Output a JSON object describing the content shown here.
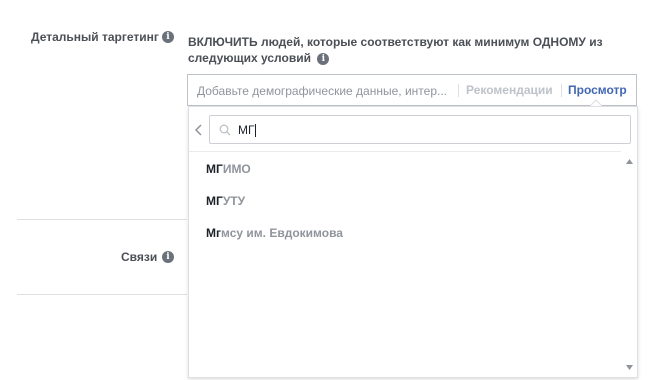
{
  "detailed_targeting": {
    "label": "Детальный таргетинг",
    "include_text": "ВКЛЮЧИТЬ людей, которые соответствуют как минимум ОДНОМУ из следующих условий",
    "placeholder": "Добавьте демографические данные, интер...",
    "recommendations_label": "Рекомендации",
    "browse_label": "Просмотр"
  },
  "connections": {
    "label": "Связи"
  },
  "dropdown": {
    "search_value": "МГ",
    "items": [
      {
        "match": "МГ",
        "rest": "ИМО"
      },
      {
        "match": "МГ",
        "rest": "УТУ"
      },
      {
        "match": "Мг",
        "rest": "мсу им. Евдокимова"
      }
    ]
  },
  "icons": {
    "info": "info-icon",
    "search": "search-icon",
    "back": "chevron-left-icon",
    "scroll_up": "scroll-up-arrow-icon",
    "scroll_down": "scroll-down-arrow-icon"
  },
  "colors": {
    "link_blue": "#4267b2",
    "label_gray": "#4b4f56",
    "placeholder_gray": "#90949c"
  }
}
